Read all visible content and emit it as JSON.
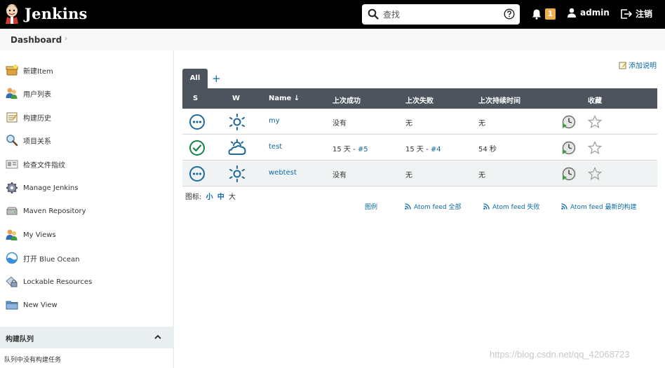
{
  "header": {
    "title": "Jenkins",
    "search_placeholder": "查找",
    "notification_count": "1",
    "user": "admin",
    "logout": "注销"
  },
  "breadcrumb": {
    "item": "Dashboard",
    "separator": "›"
  },
  "sidebar": {
    "items": [
      {
        "label": "新建Item",
        "icon": "new-item-icon"
      },
      {
        "label": "用户列表",
        "icon": "users-icon"
      },
      {
        "label": "构建历史",
        "icon": "notepad-icon"
      },
      {
        "label": "项目关系",
        "icon": "magnifier-icon"
      },
      {
        "label": "检查文件指纹",
        "icon": "fingerprint-icon"
      },
      {
        "label": "Manage Jenkins",
        "icon": "gear-icon"
      },
      {
        "label": "Maven Repository",
        "icon": "drive-icon"
      },
      {
        "label": "My Views",
        "icon": "users-icon"
      },
      {
        "label": "打开 Blue Ocean",
        "icon": "blue-ocean-icon"
      },
      {
        "label": "Lockable Resources",
        "icon": "lock-resource-icon"
      },
      {
        "label": "New View",
        "icon": "folder-icon"
      }
    ],
    "queue": {
      "title": "构建队列",
      "empty": "队列中没有构建任务"
    }
  },
  "main": {
    "add_description": "添加说明",
    "tabs": {
      "all": "All",
      "add": "+"
    },
    "columns": {
      "s": "S",
      "w": "W",
      "name": "Name ↓",
      "last_success": "上次成功",
      "last_failure": "上次失败",
      "last_duration": "上次持续时间",
      "fav": "收藏"
    },
    "jobs": [
      {
        "name": "my",
        "status": "not-built",
        "weather": "sunny",
        "last_success": "没有",
        "last_success_build": "",
        "last_failure": "无",
        "last_failure_build": "",
        "last_duration": "无"
      },
      {
        "name": "test",
        "status": "success",
        "weather": "cloudy",
        "last_success": "15 天 - ",
        "last_success_build": "#5",
        "last_failure": "15 天 - ",
        "last_failure_build": "#4",
        "last_duration": "54 秒"
      },
      {
        "name": "webtest",
        "status": "not-built",
        "weather": "sunny",
        "last_success": "没有",
        "last_success_build": "",
        "last_failure": "无",
        "last_failure_build": "",
        "last_duration": "无"
      }
    ],
    "icon_size": {
      "label": "图标:",
      "small": "小",
      "medium": "中",
      "large": "大"
    },
    "footer_links": {
      "legend": "图例",
      "atom_all": "Atom feed 全部",
      "atom_failed": "Atom feed 失败",
      "atom_latest": "Atom feed 最新的构建"
    }
  },
  "watermark": "https://blog.csdn.net/qq_42068723",
  "colors": {
    "accent": "#0b6aa2",
    "header_bg": "#000000",
    "table_head": "#4d545d",
    "success": "#138347",
    "badge": "#f0ad4e"
  }
}
